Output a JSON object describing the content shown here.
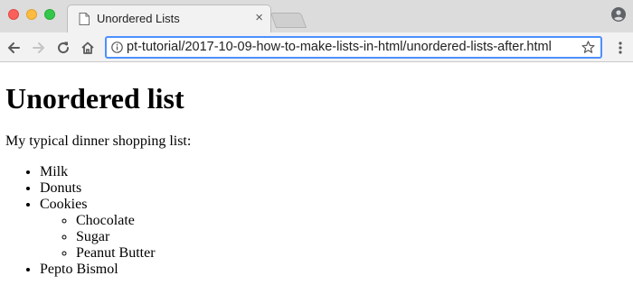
{
  "browser": {
    "tab_title": "Unordered Lists",
    "tab_close": "×",
    "url": "pt-tutorial/2017-10-09-how-to-make-lists-in-html/unordered-lists-after.html",
    "colors": {
      "close": "#fc605b",
      "minimize": "#fdbc40",
      "maximize": "#34c84a",
      "omnibox_focus": "#4d90fe"
    }
  },
  "page": {
    "heading": "Unordered list",
    "intro": "My typical dinner shopping list:",
    "items": {
      "0": {
        "label": "Milk"
      },
      "1": {
        "label": "Donuts"
      },
      "2": {
        "label": "Cookies",
        "subitems": {
          "0": {
            "label": "Chocolate"
          },
          "1": {
            "label": "Sugar"
          },
          "2": {
            "label": "Peanut Butter"
          }
        }
      },
      "3": {
        "label": "Pepto Bismol"
      }
    }
  }
}
